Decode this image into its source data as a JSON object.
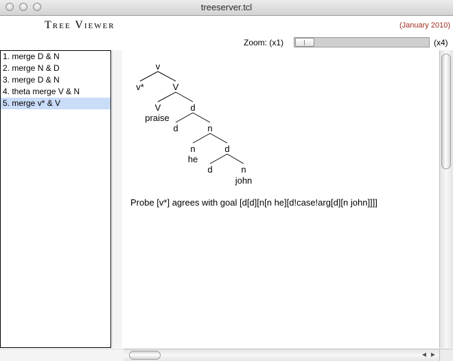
{
  "window": {
    "title": "treeserver.tcl"
  },
  "header": {
    "app_title": "Tree Viewer",
    "date": "(January 2010)"
  },
  "zoom": {
    "label": "Zoom: (x1)",
    "max_label": "(x4)",
    "value_fraction": 0.0
  },
  "derivation_steps": [
    {
      "label": "1. merge D & N",
      "selected": false
    },
    {
      "label": "2. merge N & D",
      "selected": false
    },
    {
      "label": "3. merge D & N",
      "selected": false
    },
    {
      "label": "4. theta merge V & N",
      "selected": false
    },
    {
      "label": "5. merge v* & V",
      "selected": true
    }
  ],
  "tree": {
    "nodes": [
      "v",
      "v*",
      "V",
      "V",
      "praise",
      "d",
      "d",
      "n",
      "n",
      "he",
      "d",
      "d",
      "n",
      "john"
    ]
  },
  "message": "Probe [v*] agrees with goal [d[d][n[n he][d!case!arg[d][n john]]]]",
  "colors": {
    "selection": "#c9dcf8",
    "date": "#9e2a1a"
  }
}
